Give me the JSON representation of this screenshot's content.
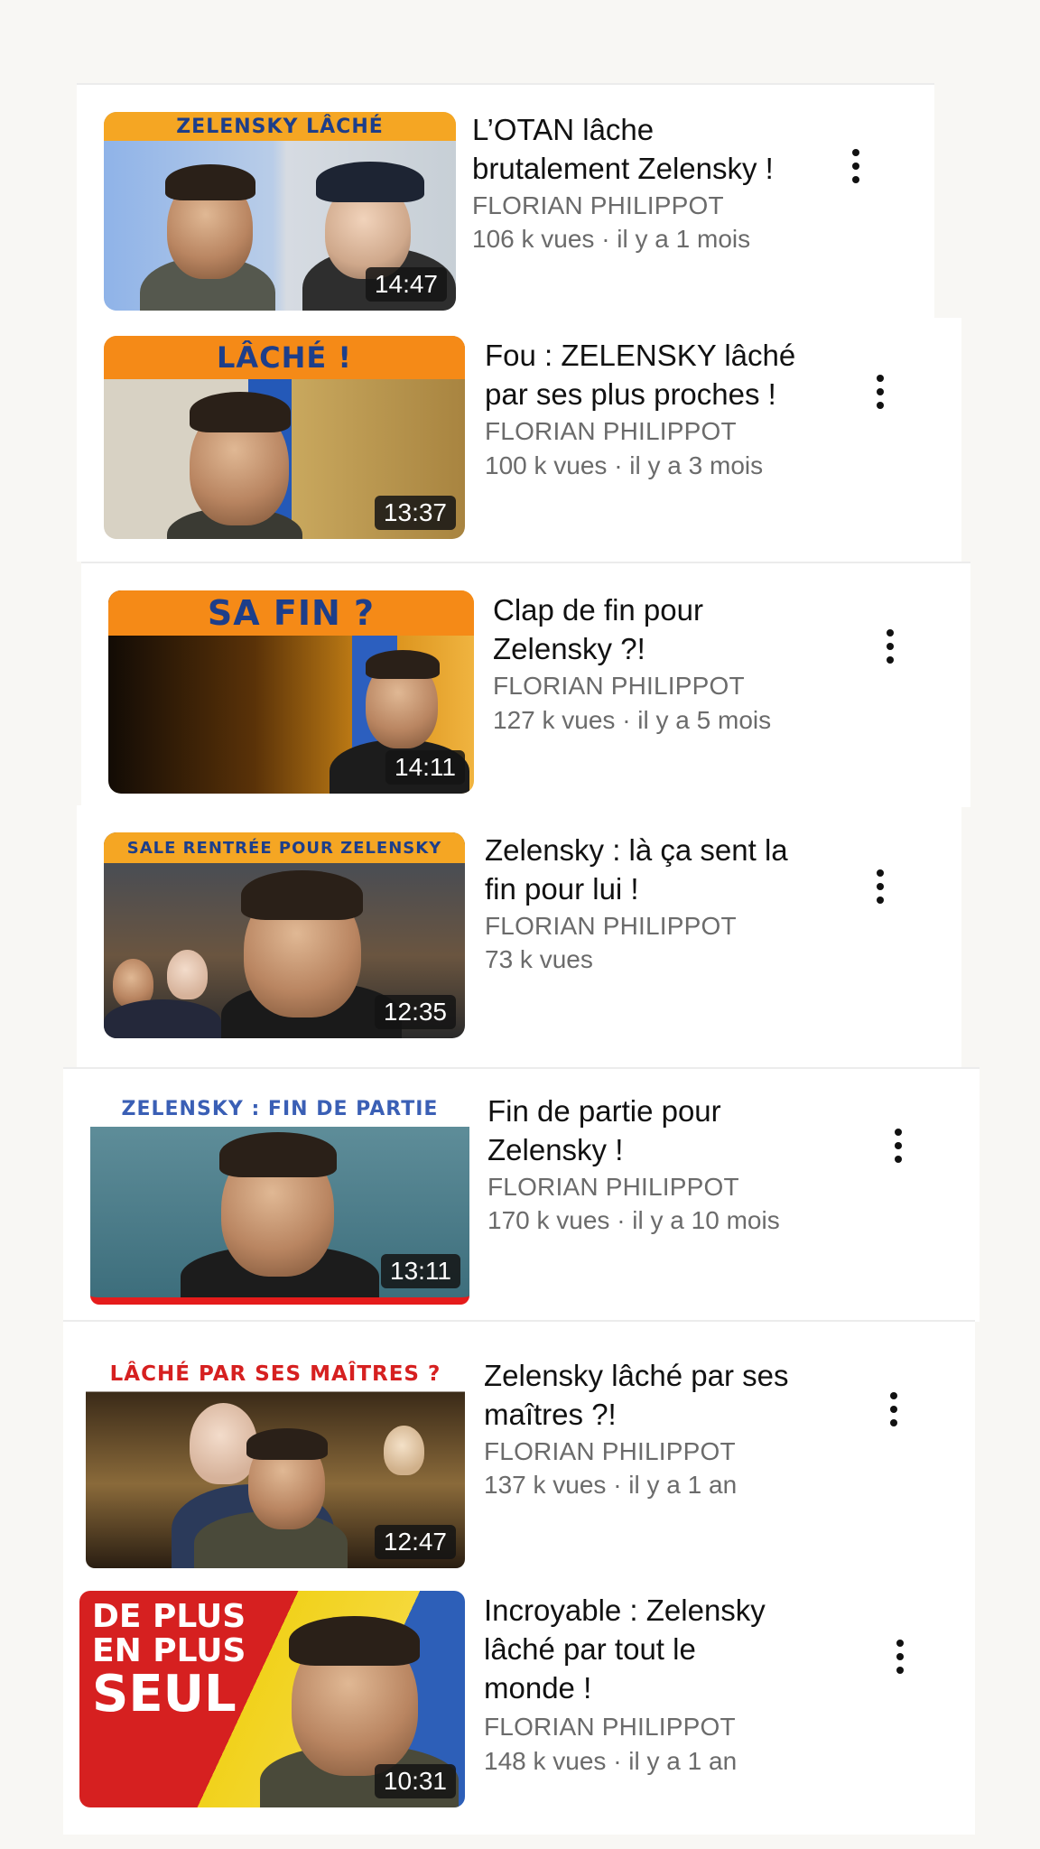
{
  "videos": [
    {
      "title_line1": "L’OTAN lâche",
      "title_line2": "brutalement Zelensky !",
      "title_line3": "",
      "channel": "FLORIAN PHILIPPOT",
      "stats": "106 k vues · il y a 1 mois",
      "duration": "14:47",
      "banner": "ZELENSKY LÂCHÉ",
      "banner_color": "#f5a623",
      "banner_text_color": "#1d3e8a"
    },
    {
      "title_line1": "Fou : ZELENSKY lâché",
      "title_line2": "par ses plus proches !",
      "title_line3": "",
      "channel": "FLORIAN PHILIPPOT",
      "stats": "100 k vues · il y a 3 mois",
      "duration": "13:37",
      "banner": "LÂCHÉ !",
      "banner_color": "#f58a17",
      "banner_text_color": "#1d3e8a"
    },
    {
      "title_line1": "Clap de fin pour",
      "title_line2": "Zelensky ?!",
      "title_line3": "",
      "channel": "FLORIAN PHILIPPOT",
      "stats": "127 k vues · il y a 5 mois",
      "duration": "14:11",
      "banner": "SA FIN ?",
      "banner_color": "#f58a17",
      "banner_text_color": "#1d3e8a"
    },
    {
      "title_line1": "Zelensky : là ça sent la",
      "title_line2": "fin pour lui !",
      "title_line3": "",
      "channel": "FLORIAN PHILIPPOT",
      "stats": "73 k vues",
      "duration": "12:35",
      "banner": "SALE RENTRÉE POUR ZELENSKY",
      "banner_color": "#f5a623",
      "banner_text_color": "#1d3e8a"
    },
    {
      "title_line1": "Fin de partie pour",
      "title_line2": "Zelensky !",
      "title_line3": "",
      "channel": "FLORIAN PHILIPPOT",
      "stats": "170 k vues · il y a 10 mois",
      "duration": "13:11",
      "banner": "ZELENSKY : FIN DE PARTIE",
      "banner_color": "#ffffff",
      "banner_text_color": "#3a5fb5"
    },
    {
      "title_line1": "Zelensky lâché par ses",
      "title_line2": "maîtres ?!",
      "title_line3": "",
      "channel": "FLORIAN PHILIPPOT",
      "stats": "137 k vues · il y a 1 an",
      "duration": "12:47",
      "banner": "LÂCHÉ PAR SES MAÎTRES ?",
      "banner_color": "#ffffff",
      "banner_text_color": "#d62020"
    },
    {
      "title_line1": "Incroyable : Zelensky",
      "title_line2": "lâché par tout le",
      "title_line3": "monde !",
      "channel": "FLORIAN PHILIPPOT",
      "stats": "148 k vues · il y a 1 an",
      "duration": "10:31",
      "banner": "DE PLUS",
      "banner_color": "#d62020",
      "banner_text_color": "#ffffff",
      "banner_line2": "EN PLUS",
      "banner_line3": "SEUL"
    }
  ]
}
